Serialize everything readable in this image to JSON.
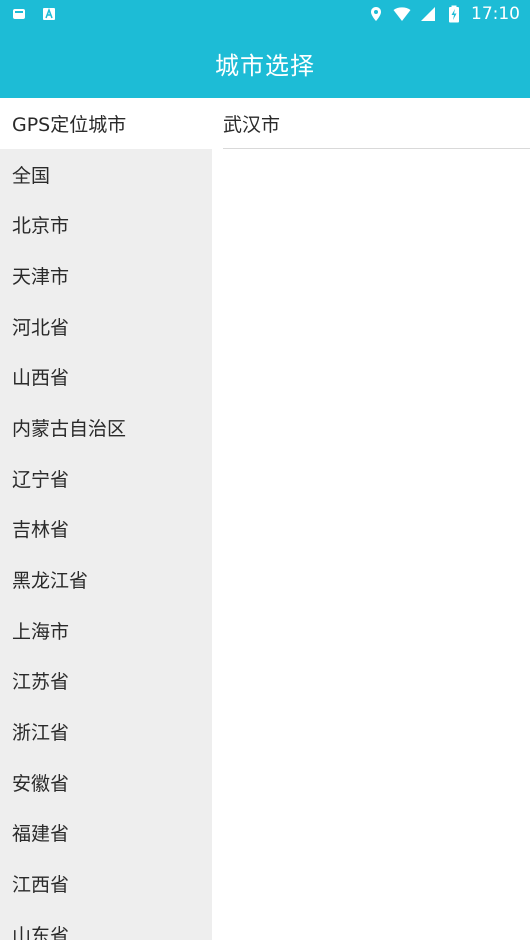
{
  "status_bar": {
    "time": "17:10",
    "left_icons": [
      "sim-card-icon",
      "a-keyboard-icon"
    ],
    "right_icons": [
      "location-icon",
      "wifi-icon",
      "signal-icon",
      "battery-charging-icon"
    ]
  },
  "app_bar": {
    "title": "城市选择"
  },
  "left_list": {
    "items": [
      {
        "label": "GPS定位城市",
        "selected": true
      },
      {
        "label": "全国"
      },
      {
        "label": "北京市"
      },
      {
        "label": "天津市"
      },
      {
        "label": "河北省"
      },
      {
        "label": "山西省"
      },
      {
        "label": "内蒙古自治区"
      },
      {
        "label": "辽宁省"
      },
      {
        "label": "吉林省"
      },
      {
        "label": "黑龙江省"
      },
      {
        "label": "上海市"
      },
      {
        "label": "江苏省"
      },
      {
        "label": "浙江省"
      },
      {
        "label": "安徽省"
      },
      {
        "label": "福建省"
      },
      {
        "label": "江西省"
      },
      {
        "label": "山东省"
      }
    ]
  },
  "right_list": {
    "items": [
      {
        "label": "武汉市"
      }
    ]
  },
  "colors": {
    "primary": "#1dbcd6",
    "left_bg": "#eeeeee",
    "selected_bg": "#ffffff",
    "text": "#2a2a2a",
    "divider": "#d9d9d9"
  }
}
